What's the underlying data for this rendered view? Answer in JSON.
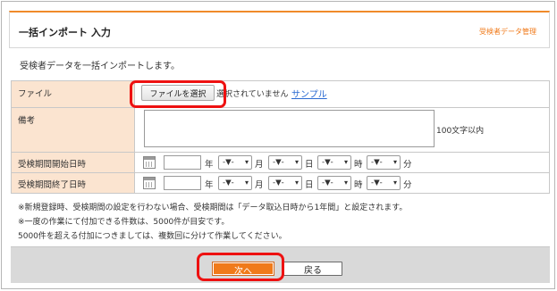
{
  "header": {
    "title": "一括インポート 入力",
    "mgmt_link": "受検者データ管理"
  },
  "intro": "受検者データを一括インポートします。",
  "form": {
    "file": {
      "label": "ファイル",
      "button": "ファイルを選択",
      "status": "選択されていません",
      "sample_link": "サンプル"
    },
    "note": {
      "label": "備考",
      "limit": "100文字以内",
      "value": ""
    },
    "start": {
      "label": "受検期間開始日時",
      "year_unit": "年",
      "month_unit": "月",
      "day_unit": "日",
      "hour_unit": "時",
      "minute_unit": "分",
      "month_value": "-▼-",
      "day_value": "-▼-",
      "hour_value": "-▼-",
      "minute_value": "-▼-"
    },
    "end": {
      "label": "受検期間終了日時",
      "year_unit": "年",
      "month_unit": "月",
      "day_unit": "日",
      "hour_unit": "時",
      "minute_unit": "分",
      "month_value": "-▼-",
      "day_value": "-▼-",
      "hour_value": "-▼-",
      "minute_value": "-▼-"
    }
  },
  "notes": [
    "※新規登録時、受検期間の設定を行わない場合、受検期間は「データ取込日時から1年間」と設定されます。",
    "※一度の作業にて付加できる件数は、5000件が目安です。",
    "5000件を超える付加につきましては、複数回に分けて作業してください。"
  ],
  "buttons": {
    "next": "次へ",
    "back": "戻る"
  },
  "colors": {
    "accent": "#f07a1a",
    "label_bg": "#fbe4d0",
    "highlight": "#ee1111",
    "link": "#2a6ad2"
  },
  "icons": {
    "calendar": "calendar-icon",
    "select_arrow": "chevron-down-icon"
  }
}
